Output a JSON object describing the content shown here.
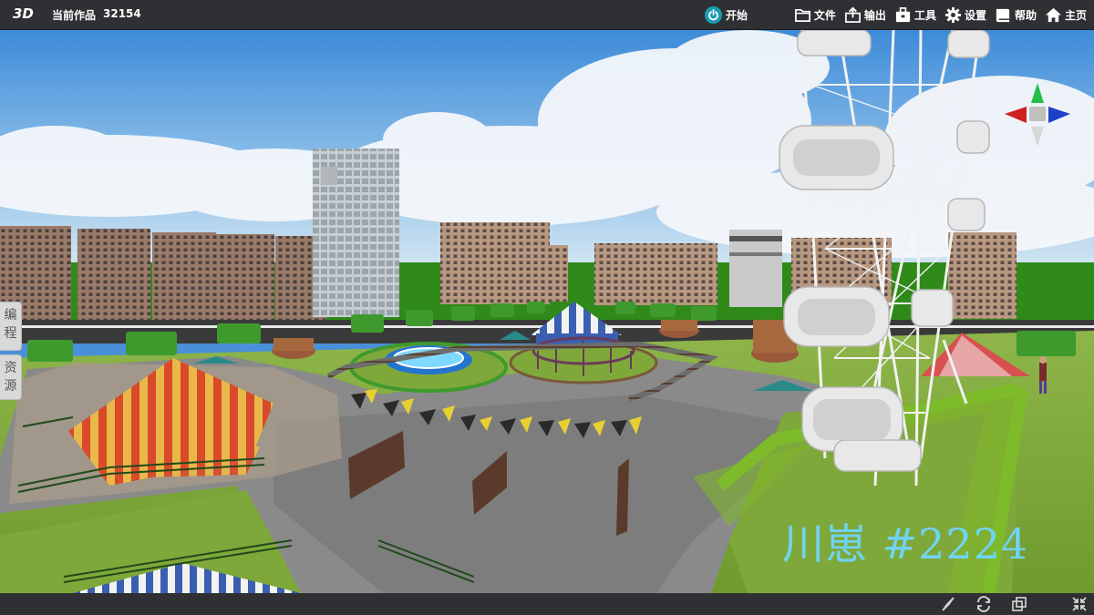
{
  "topbar": {
    "brand": "3D",
    "work_label": "当前作品",
    "work_id": "32154",
    "start_label": "开始",
    "menu": [
      {
        "label": "文件",
        "icon": "folder-icon"
      },
      {
        "label": "输出",
        "icon": "export-icon"
      },
      {
        "label": "工具",
        "icon": "toolbox-icon"
      },
      {
        "label": "设置",
        "icon": "gear-icon"
      },
      {
        "label": "帮助",
        "icon": "book-icon"
      },
      {
        "label": "主页",
        "icon": "home-icon"
      }
    ]
  },
  "sidebar": {
    "tabs": [
      {
        "label": "编\n程"
      },
      {
        "label": "资\n源"
      }
    ]
  },
  "scene": {
    "watermark": "川崽 #2224",
    "colors": {
      "sky": "#4a90d8",
      "grass": "#7fa83a",
      "path": "#8d8d8d",
      "gizmo_y": "#22c04a",
      "gizmo_x": "#d02020",
      "gizmo_z": "#1e3fc8"
    }
  },
  "bottombar": {
    "icons": [
      "compass-icon",
      "rotate-icon",
      "copy-icon",
      "shrink-icon"
    ]
  }
}
